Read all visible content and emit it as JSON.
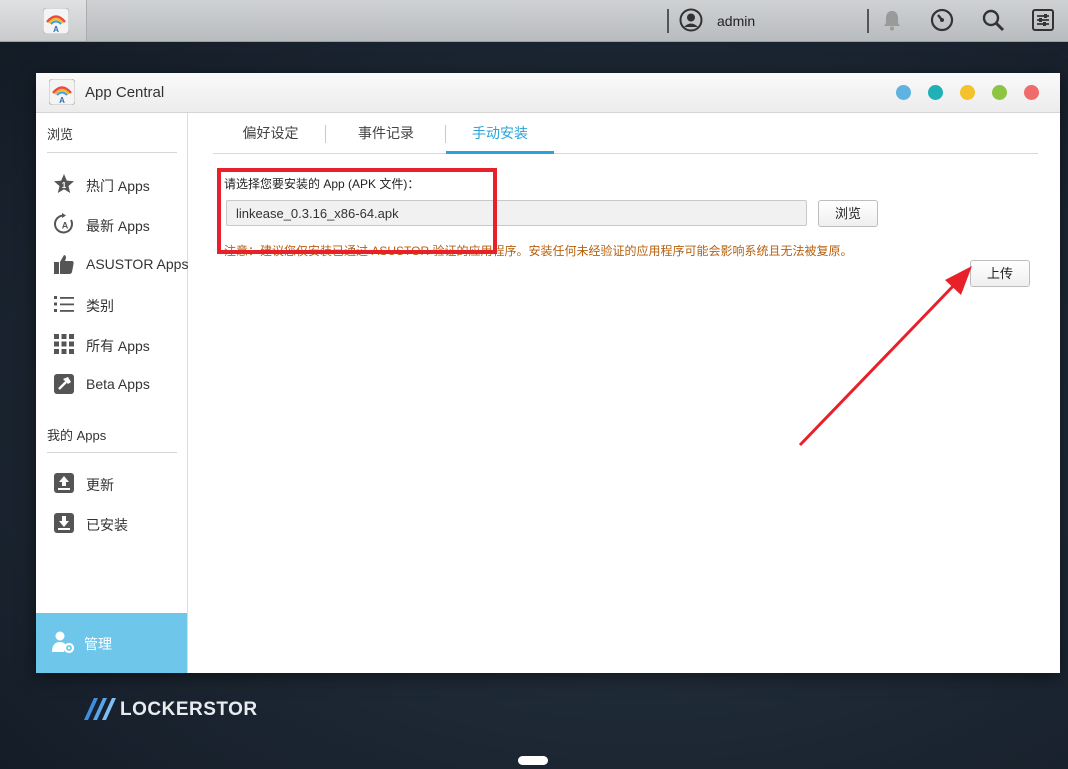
{
  "topbar": {
    "username": "admin",
    "icons": [
      "asustor-logo-icon",
      "user-avatar-icon",
      "notification-bell-icon",
      "dashboard-gauge-icon",
      "search-icon",
      "settings-sliders-icon"
    ]
  },
  "window": {
    "title": "App Central",
    "controls": [
      {
        "name": "help",
        "color": "#5fb3e0"
      },
      {
        "name": "info",
        "color": "#1fb1b6"
      },
      {
        "name": "minimize",
        "color": "#f5c22b"
      },
      {
        "name": "maximize",
        "color": "#8dc542"
      },
      {
        "name": "close",
        "color": "#f06b6b"
      }
    ]
  },
  "sidebar": {
    "browse_label": "浏览",
    "browse_items": [
      {
        "label": "热门 Apps",
        "icon": "star-icon"
      },
      {
        "label": "最新 Apps",
        "icon": "new-apps-icon"
      },
      {
        "label": "ASUSTOR Apps",
        "icon": "thumbs-up-icon"
      },
      {
        "label": "类别",
        "icon": "list-icon"
      },
      {
        "label": "所有 Apps",
        "icon": "grid-icon"
      },
      {
        "label": "Beta Apps",
        "icon": "hammer-icon"
      }
    ],
    "my_apps_label": "我的 Apps",
    "my_items": [
      {
        "label": "更新",
        "icon": "update-icon"
      },
      {
        "label": "已安装",
        "icon": "installed-icon"
      }
    ],
    "admin_label": "管理"
  },
  "tabs": [
    {
      "label": "偏好设定",
      "active": false
    },
    {
      "label": "事件记录",
      "active": false
    },
    {
      "label": "手动安装",
      "active": true
    }
  ],
  "install": {
    "prompt": "请选择您要安装的 App (APK 文件)：",
    "file_value": "linkease_0.3.16_x86-64.apk",
    "browse_button": "浏览",
    "note": "注意：建议您仅安装已通过 ASUSTOR 验证的应用程序。安装任何未经验证的应用程序可能会影响系统且无法被复原。",
    "upload_button": "上传"
  },
  "brand": "LOCKERSTOR",
  "colors": {
    "accent": "#2aa3d8",
    "admin_bg": "#6ec7eb",
    "warning_text": "#b7600f",
    "annotation_red": "#e8202a"
  }
}
